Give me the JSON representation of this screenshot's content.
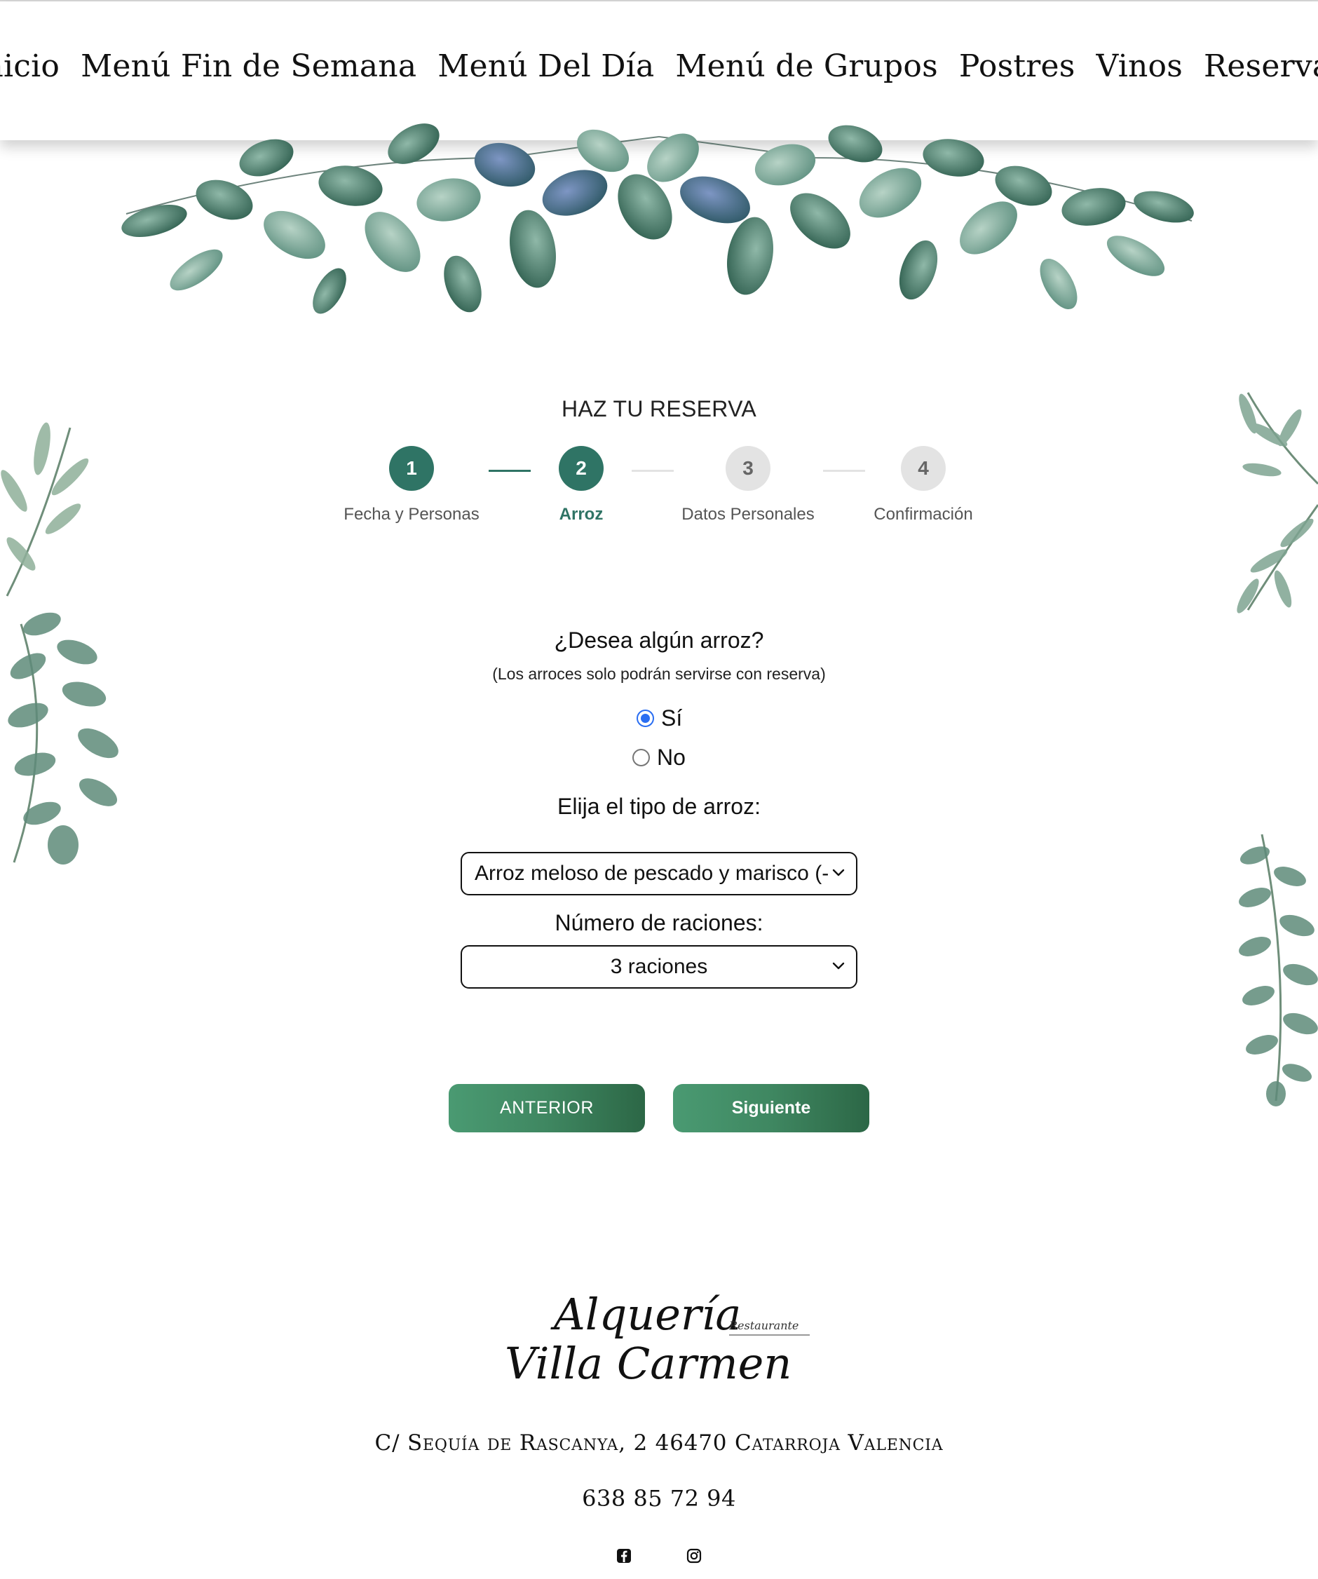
{
  "nav": {
    "items": [
      "Inicio",
      "Menú Fin de Semana",
      "Menú Del Día",
      "Menú de Grupos",
      "Postres",
      "Vinos",
      "Reservas"
    ]
  },
  "reservation": {
    "title": "HAZ TU RESERVA",
    "steps": [
      {
        "number": "1",
        "label": "Fecha y Personas",
        "state": "completed"
      },
      {
        "number": "2",
        "label": "Arroz",
        "state": "current"
      },
      {
        "number": "3",
        "label": "Datos Personales",
        "state": "pending"
      },
      {
        "number": "4",
        "label": "Confirmación",
        "state": "pending"
      }
    ],
    "question": "¿Desea algún arroz?",
    "note": "(Los arroces solo podrán servirse con reserva)",
    "options": {
      "yes_label": "Sí",
      "no_label": "No",
      "selected": "Sí"
    },
    "rice_type_label": "Elija el tipo de arroz:",
    "rice_type_value": "Arroz meloso de pescado y marisco (-",
    "portions_label": "Número de raciones:",
    "portions_value": "3 raciones",
    "previous_button": "ANTERIOR",
    "next_button": "Siguiente"
  },
  "footer": {
    "logo_line1": "Alquería",
    "logo_tag": "Restaurante",
    "logo_line2": "Villa Carmen",
    "address": "C/ Sequía de Rascanya, 2 46470 Catarroja Valencia",
    "phone": "638 85 72 94",
    "social_icons": [
      "facebook-icon",
      "instagram-icon"
    ]
  },
  "colors": {
    "accent": "#2f7465",
    "button_gradient_start": "#4a9a72",
    "button_gradient_end": "#2c6746",
    "step_inactive": "#e3e3e3",
    "radio_checked": "#2a6ef2"
  }
}
